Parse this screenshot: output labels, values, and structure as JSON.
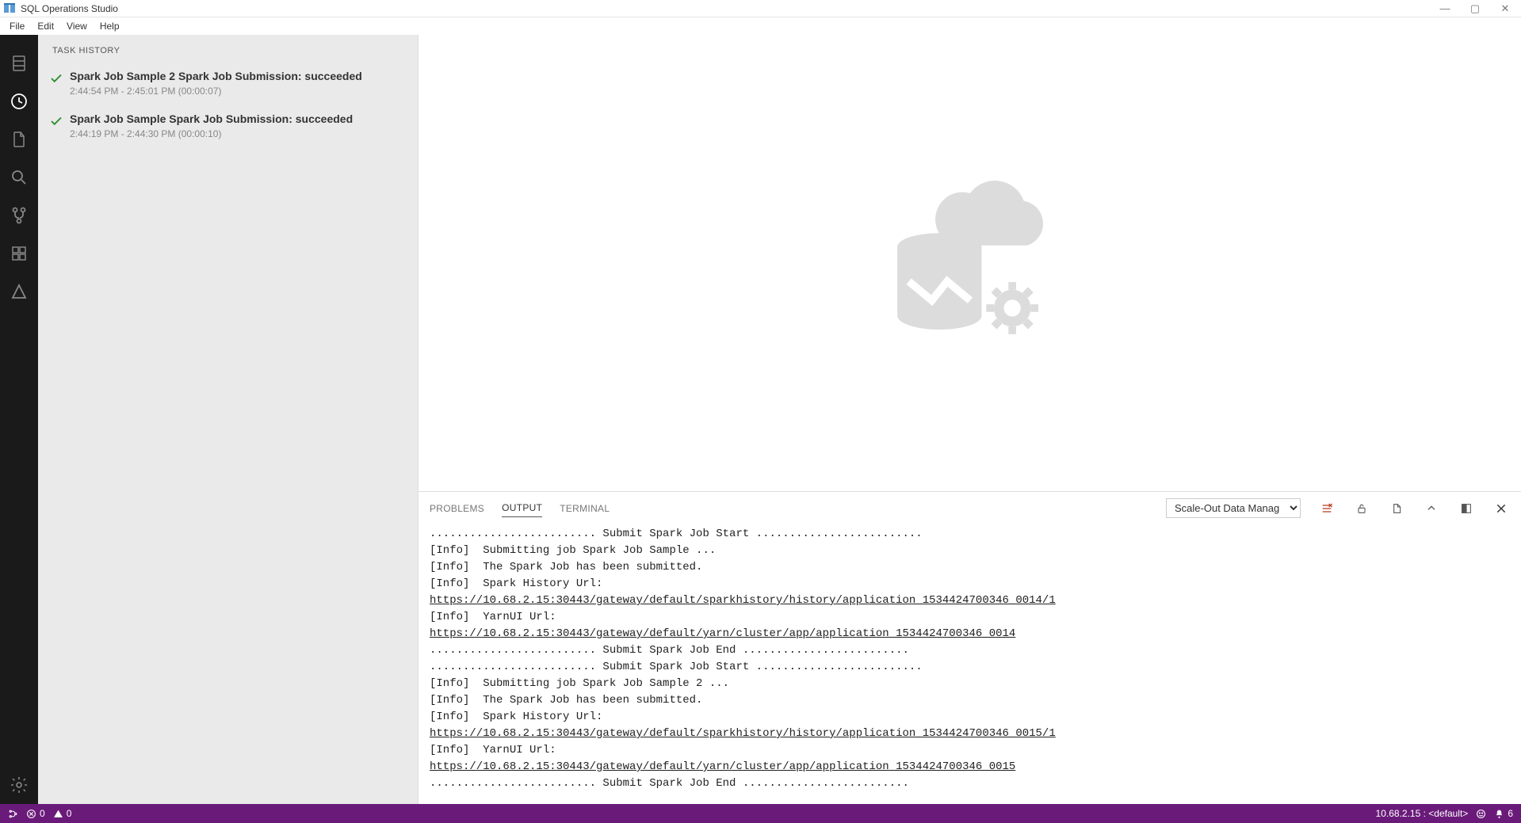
{
  "window": {
    "title": "SQL Operations Studio"
  },
  "menu": {
    "items": [
      "File",
      "Edit",
      "View",
      "Help"
    ]
  },
  "sidebar": {
    "title": "TASK HISTORY",
    "tasks": [
      {
        "title": "Spark Job Sample 2 Spark Job Submission: succeeded",
        "time": "2:44:54 PM - 2:45:01 PM (00:00:07)"
      },
      {
        "title": "Spark Job Sample Spark Job Submission: succeeded",
        "time": "2:44:19 PM - 2:44:30 PM (00:00:10)"
      }
    ]
  },
  "panel": {
    "tabs": {
      "problems": "PROBLEMS",
      "output": "OUTPUT",
      "terminal": "TERMINAL"
    },
    "dropdown": "Scale-Out Data Manag",
    "output_lines": [
      "......................... Submit Spark Job Start .........................",
      "[Info]  Submitting job Spark Job Sample ...",
      "[Info]  The Spark Job has been submitted.",
      "[Info]  Spark History Url:",
      "https://10.68.2.15:30443/gateway/default/sparkhistory/history/application_1534424700346_0014/1",
      "[Info]  YarnUI Url:",
      "https://10.68.2.15:30443/gateway/default/yarn/cluster/app/application_1534424700346_0014",
      "......................... Submit Spark Job End .........................",
      "......................... Submit Spark Job Start .........................",
      "[Info]  Submitting job Spark Job Sample 2 ...",
      "[Info]  The Spark Job has been submitted.",
      "[Info]  Spark History Url:",
      "https://10.68.2.15:30443/gateway/default/sparkhistory/history/application_1534424700346_0015/1",
      "[Info]  YarnUI Url:",
      "https://10.68.2.15:30443/gateway/default/yarn/cluster/app/application_1534424700346_0015",
      "......................... Submit Spark Job End ........................."
    ],
    "link_indices": [
      4,
      6,
      12,
      14
    ]
  },
  "status": {
    "errors": "0",
    "warnings": "0",
    "connection": "10.68.2.15 : <default>",
    "notifications": "6"
  }
}
